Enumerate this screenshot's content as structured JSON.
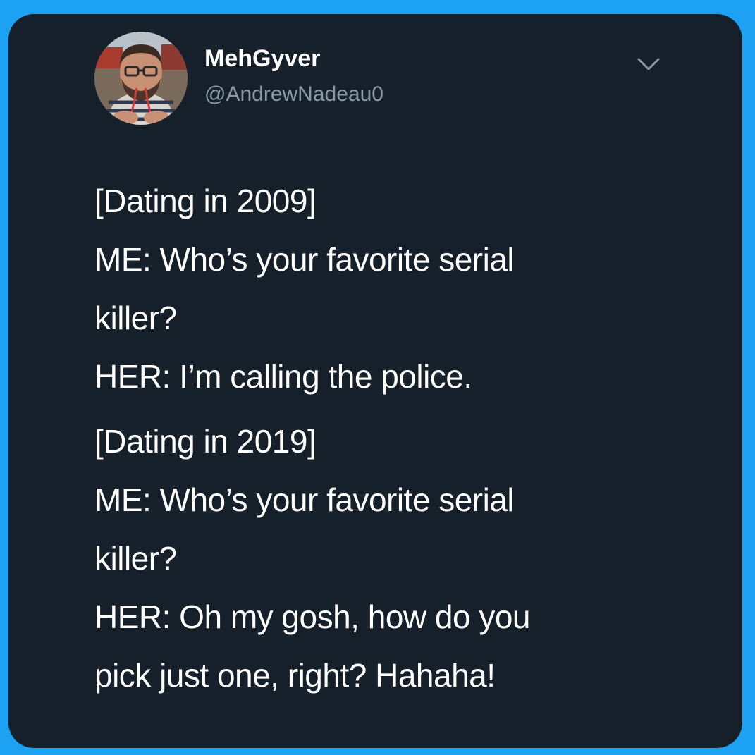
{
  "author": {
    "display_name": "MehGyver",
    "handle": "@AndrewNadeau0",
    "avatar_icon": "profile-photo",
    "menu_icon": "chevron-down-icon"
  },
  "tweet": {
    "blocks": [
      {
        "lines": [
          "[Dating in 2009]",
          "ME: Who’s your favorite serial",
          "killer?",
          "HER: I’m calling the police."
        ]
      },
      {
        "lines": [
          "[Dating in 2019]",
          "ME: Who’s your favorite serial",
          "killer?",
          "HER: Oh my gosh, how do you",
          "pick just one, right? Hahaha!"
        ]
      }
    ]
  },
  "colors": {
    "border": "#1DA1F2",
    "card_background": "#16202b",
    "text_primary": "#ffffff",
    "text_secondary": "#8899a6"
  }
}
